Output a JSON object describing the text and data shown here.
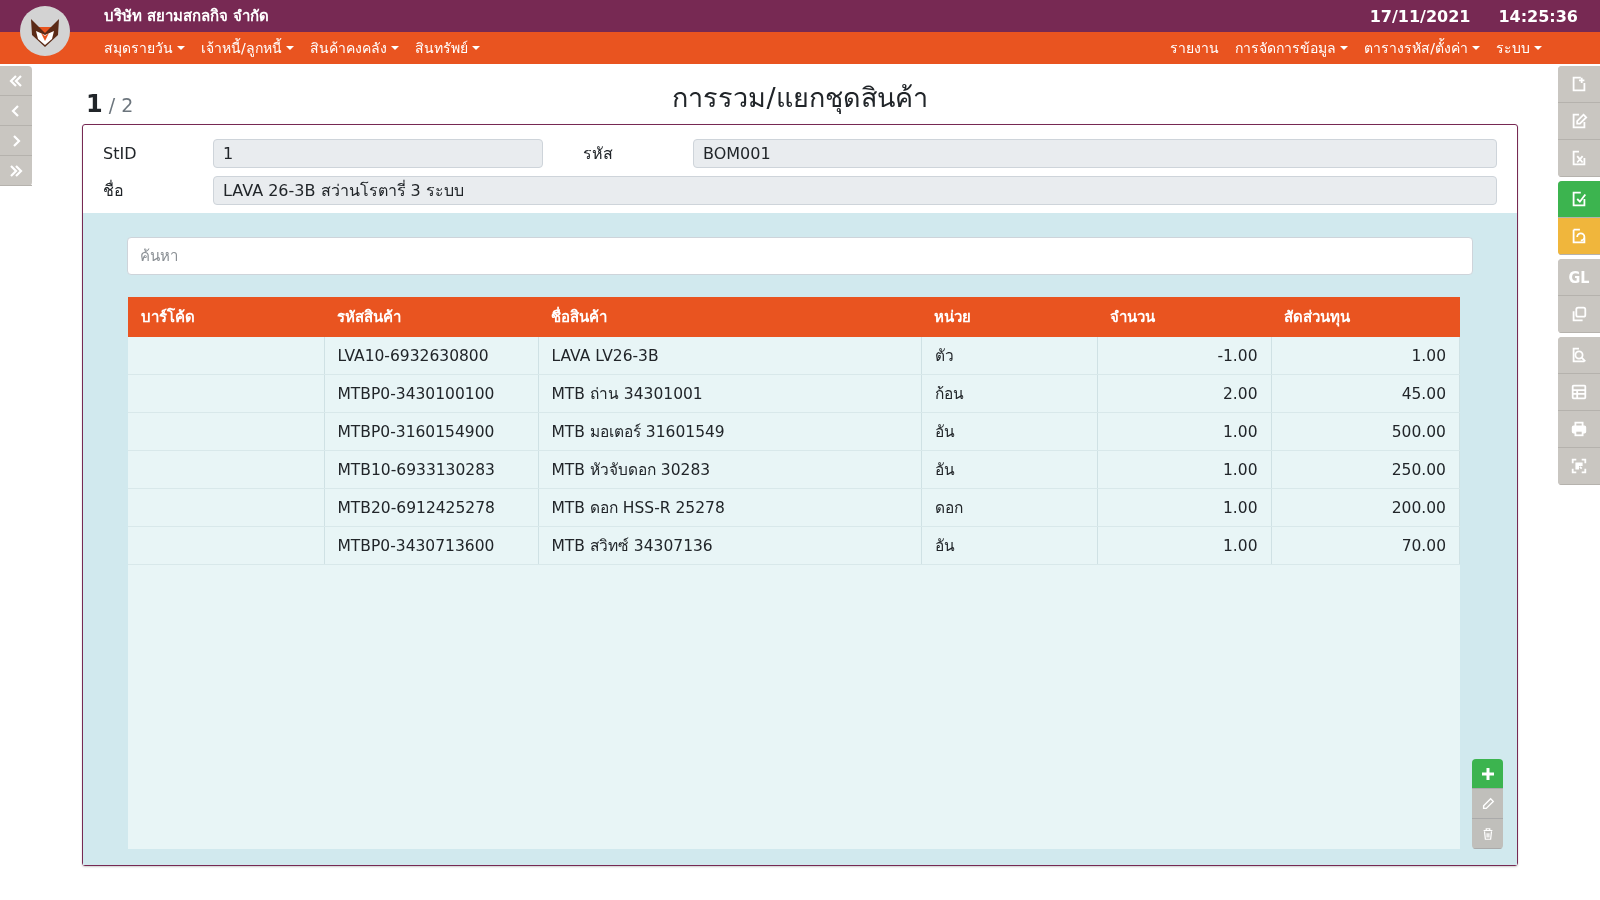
{
  "header": {
    "company": "บริษัท สยามสกลกิจ จำกัด",
    "date": "17/11/2021",
    "time": "14:25:36"
  },
  "menu_left": [
    {
      "label": "สมุดรายวัน",
      "dropdown": true
    },
    {
      "label": "เจ้าหนี้/ลูกหนี้",
      "dropdown": true
    },
    {
      "label": "สินค้าคงคลัง",
      "dropdown": true
    },
    {
      "label": "สินทรัพย์",
      "dropdown": true
    }
  ],
  "menu_right": [
    {
      "label": "รายงาน",
      "dropdown": false
    },
    {
      "label": "การจัดการข้อมูล",
      "dropdown": true
    },
    {
      "label": "ตารางรหัส/ตั้งค่า",
      "dropdown": true
    },
    {
      "label": "ระบบ",
      "dropdown": true
    }
  ],
  "pager": {
    "current": "1",
    "total": "/ 2"
  },
  "title": "การรวม/แยกชุดสินค้า",
  "form": {
    "stid_label": "StID",
    "stid_value": "1",
    "code_label": "รหัส",
    "code_value": "BOM001",
    "name_label": "ชื่อ",
    "name_value": "LAVA 26-3B สว่านโรตารี่ 3 ระบบ"
  },
  "search": {
    "placeholder": "ค้นหา"
  },
  "table": {
    "columns": [
      "บาร์โค้ด",
      "รหัสสินค้า",
      "ชื่อสินค้า",
      "หน่วย",
      "จำนวน",
      "สัดส่วนทุน"
    ],
    "rows": [
      {
        "product_code": "LVA10-6932630800",
        "product_name": "LAVA LV26-3B",
        "unit": "ตัว",
        "quantity": "-1.00",
        "cost_ratio": "1.00"
      },
      {
        "product_code": "MTBP0-3430100100",
        "product_name": "MTB ถ่าน 34301001",
        "unit": "ก้อน",
        "quantity": "2.00",
        "cost_ratio": "45.00"
      },
      {
        "product_code": "MTBP0-3160154900",
        "product_name": "MTB มอเตอร์ 31601549",
        "unit": "อัน",
        "quantity": "1.00",
        "cost_ratio": "500.00"
      },
      {
        "product_code": "MTB10-6933130283",
        "product_name": "MTB หัวจับดอก 30283",
        "unit": "อัน",
        "quantity": "1.00",
        "cost_ratio": "250.00"
      },
      {
        "product_code": "MTB20-6912425278",
        "product_name": "MTB ดอก HSS-R 25278",
        "unit": "ดอก",
        "quantity": "1.00",
        "cost_ratio": "200.00"
      },
      {
        "product_code": "MTBP0-3430713600",
        "product_name": "MTB สวิทซ์ 34307136",
        "unit": "อัน",
        "quantity": "1.00",
        "cost_ratio": "70.00"
      }
    ]
  },
  "toolbar": [
    [
      {
        "kind": "add"
      },
      {
        "kind": "edit"
      },
      {
        "kind": "cancel"
      }
    ],
    [
      {
        "kind": "save",
        "color": "#3cb44f"
      },
      {
        "kind": "undo",
        "color": "#f0b63c"
      }
    ],
    [
      {
        "kind": "gl",
        "label": "GL"
      },
      {
        "kind": "copy"
      }
    ],
    [
      {
        "kind": "find"
      },
      {
        "kind": "table"
      },
      {
        "kind": "print"
      },
      {
        "kind": "scan"
      }
    ]
  ]
}
